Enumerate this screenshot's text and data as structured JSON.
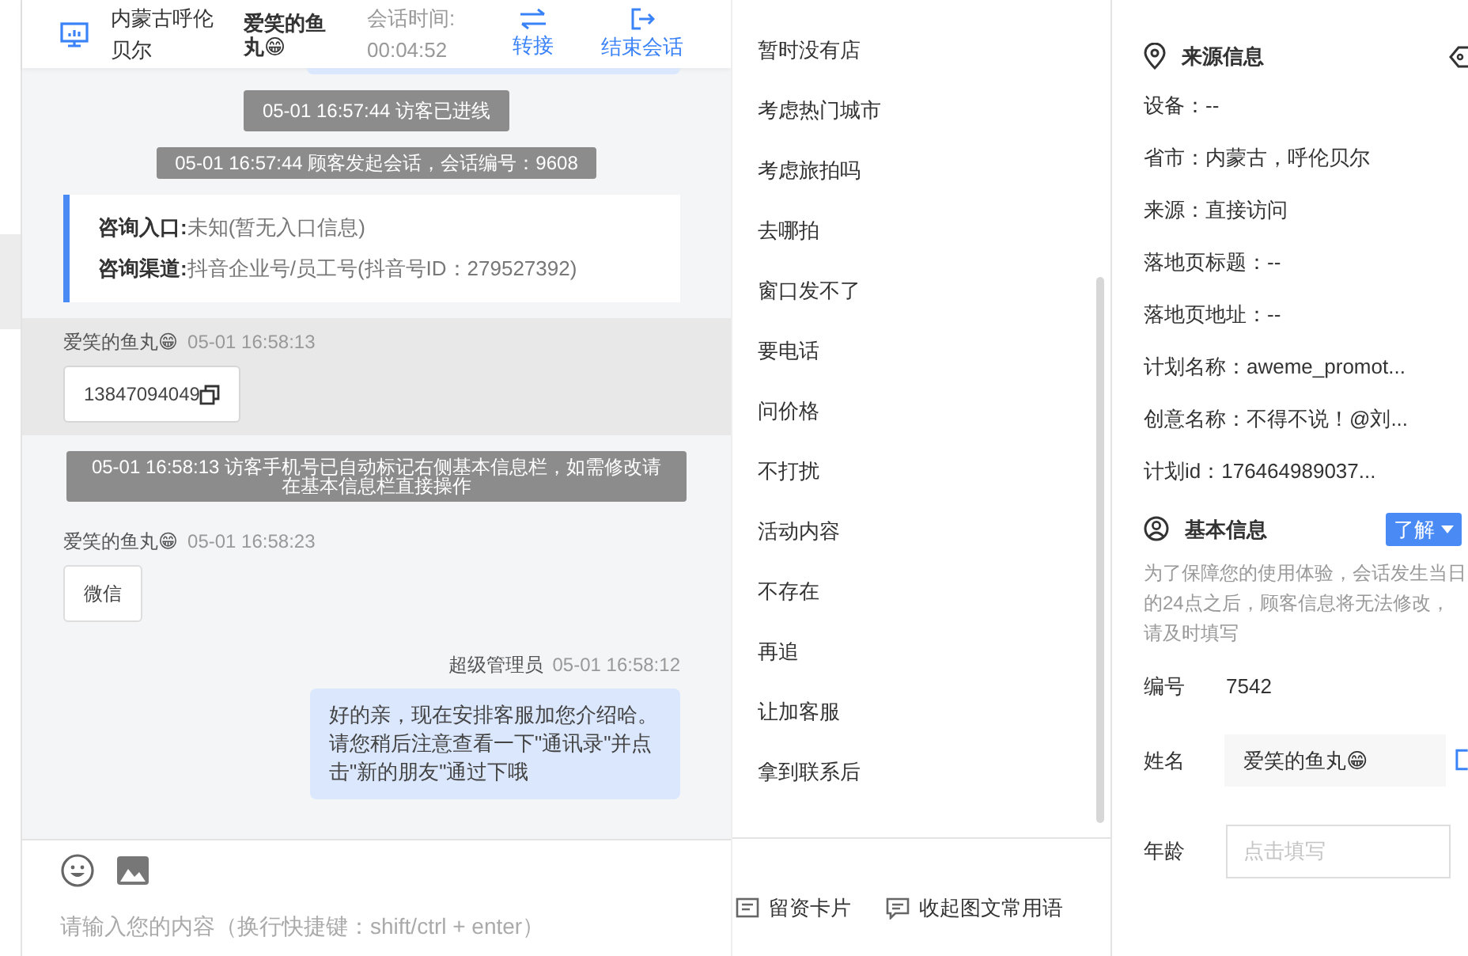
{
  "chat_header": {
    "location": "内蒙古呼伦贝尔",
    "visitor_name": "爱笑的鱼丸😁",
    "timer_label": "会话时间:",
    "timer_value": "00:04:52",
    "actions": [
      {
        "kind": "transfer",
        "label": "转接"
      },
      {
        "kind": "end",
        "label": "结束会话"
      }
    ]
  },
  "messages": [
    {
      "kind": "system",
      "text": "05-01 16:57:44 访客已进线"
    },
    {
      "kind": "system",
      "text": "05-01 16:57:44 顾客发起会话，会话编号：9608"
    },
    {
      "kind": "info",
      "lines": [
        {
          "label": "咨询入口:",
          "value": "未知(暂无入口信息)"
        },
        {
          "label": "咨询渠道:",
          "value": "抖音企业号/员工号(抖音号ID：279527392)"
        }
      ]
    },
    {
      "kind": "visitor",
      "sender": "爱笑的鱼丸😁",
      "time": "05-01 16:58:13",
      "text": "13847094049",
      "copyable": true,
      "highlighted": true
    },
    {
      "kind": "system",
      "text": "05-01 16:58:13 访客手机号已自动标记右侧基本信息栏，如需修改请在基本信息栏直接操作"
    },
    {
      "kind": "visitor",
      "sender": "爱笑的鱼丸😁",
      "time": "05-01 16:58:23",
      "text": "微信",
      "copyable": false,
      "highlighted": false
    },
    {
      "kind": "agent",
      "sender": "超级管理员",
      "time": "05-01 16:58:12",
      "text": "好的亲，现在安排客服加您介绍哈。请您稍后注意查看一下\"通讯录\"并点击\"新的朋友\"通过下哦"
    }
  ],
  "composer": {
    "placeholder": "请输入您的内容（换行快捷键：shift/ctrl + enter）",
    "tools": [
      {
        "kind": "card",
        "label": "留资卡片"
      },
      {
        "kind": "collapse",
        "label": "收起图文常用语"
      }
    ]
  },
  "quick_replies": [
    "暂时没有店",
    "考虑热门城市",
    "考虑旅拍吗",
    "去哪拍",
    "窗口发不了",
    "要电话",
    "问价格",
    "不打扰",
    "活动内容",
    "不存在",
    "再追",
    "让加客服",
    "拿到联系后"
  ],
  "source_info": {
    "title": "来源信息",
    "rows": [
      "设备：--",
      "省市：内蒙古，呼伦贝尔",
      "来源：直接访问",
      "落地页标题：--",
      "落地页地址：--",
      "计划名称：aweme_promot...",
      "创意名称：不得不说！@刘...",
      "计划id：176464989037..."
    ]
  },
  "basic_info": {
    "title": "基本信息",
    "dropdown": "了解",
    "notice": "为了保障您的使用体验，会话发生当日的24点之后，顾客信息将无法修改，请及时填写",
    "fields": [
      {
        "kind": "static",
        "label": "编号",
        "value": "7542"
      },
      {
        "kind": "readonly",
        "label": "姓名",
        "value": "爱笑的鱼丸😁"
      },
      {
        "kind": "input",
        "label": "年龄",
        "placeholder": "点击填写"
      }
    ]
  }
}
